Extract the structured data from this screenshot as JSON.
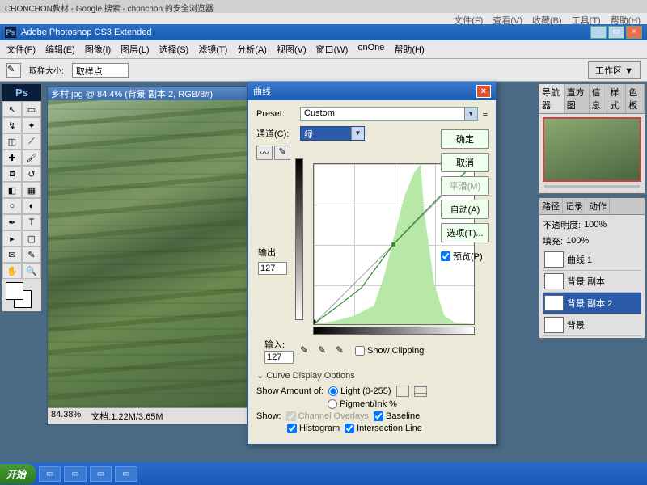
{
  "browser": {
    "tab_title": "CHONCHON教材 - Google 搜索 - chonchon 的安全浏览器",
    "menus": [
      "文件(F)",
      "查看(V)",
      "收藏(B)",
      "工具(T)",
      "帮助(H)"
    ]
  },
  "app": {
    "title": "Adobe Photoshop CS3 Extended",
    "ps_badge": "Ps"
  },
  "menubar": [
    "文件(F)",
    "编辑(E)",
    "图像(I)",
    "图层(L)",
    "选择(S)",
    "滤镜(T)",
    "分析(A)",
    "视图(V)",
    "窗口(W)",
    "onOne",
    "帮助(H)"
  ],
  "options_bar": {
    "sample_label": "取样大小:",
    "sample_value": "取样点",
    "workspace": "工作区 ▼"
  },
  "document": {
    "title": "乡村.jpg @ 84.4% (背景 副本 2, RGB/8#)",
    "zoom": "84.38%",
    "filesize": "文档:1.22M/3.65M"
  },
  "curves": {
    "title": "曲线",
    "preset_label": "Preset:",
    "preset_value": "Custom",
    "channel_label": "通道(C):",
    "channel_value": "绿",
    "output_label": "输出:",
    "output_value": "127",
    "input_label": "输入:",
    "input_value": "127",
    "show_clipping": "Show Clipping",
    "expand": "Curve Display Options",
    "show_amount": "Show Amount of:",
    "light": "Light (0-255)",
    "pigment": "Pigment/Ink %",
    "show": "Show:",
    "channel_overlays": "Channel Overlays",
    "baseline": "Baseline",
    "histogram": "Histogram",
    "intersection": "Intersection Line",
    "buttons": {
      "ok": "确定",
      "cancel": "取消",
      "smooth": "平滑(M)",
      "auto": "自动(A)",
      "options": "选项(T)...",
      "preview": "预览(P)"
    }
  },
  "panels": {
    "nav_tabs": [
      "导航器",
      "直方图",
      "信息",
      "样式",
      "色板"
    ],
    "paths_tabs": [
      "路径",
      "记录",
      "动作"
    ],
    "opacity_label": "不透明度:",
    "opacity_value": "100%",
    "fill_label": "填充:",
    "fill_value": "100%",
    "layers": [
      "曲线 1",
      "背景 副本",
      "背景 副本 2",
      "背景"
    ]
  },
  "taskbar": {
    "start": "开始",
    "items": [
      "",
      "",
      "",
      "",
      ""
    ]
  },
  "chart_data": {
    "type": "line",
    "title": "曲线 (Curves) — 绿 channel",
    "xlabel": "输入",
    "ylabel": "输出",
    "xlim": [
      0,
      255
    ],
    "ylim": [
      0,
      255
    ],
    "series": [
      {
        "name": "baseline",
        "x": [
          0,
          255
        ],
        "y": [
          0,
          255
        ]
      },
      {
        "name": "curve",
        "x": [
          0,
          76,
          127,
          255
        ],
        "y": [
          0,
          58,
          127,
          255
        ]
      }
    ],
    "histogram": {
      "channel": "绿",
      "bins_x": [
        0,
        32,
        64,
        96,
        112,
        128,
        144,
        160,
        170,
        176,
        192,
        208,
        224,
        255
      ],
      "heights_norm": [
        0.0,
        0.02,
        0.05,
        0.12,
        0.3,
        0.55,
        0.8,
        0.95,
        1.0,
        0.7,
        0.25,
        0.05,
        0.01,
        0.0
      ]
    },
    "selected_point": {
      "input": 127,
      "output": 127
    }
  }
}
